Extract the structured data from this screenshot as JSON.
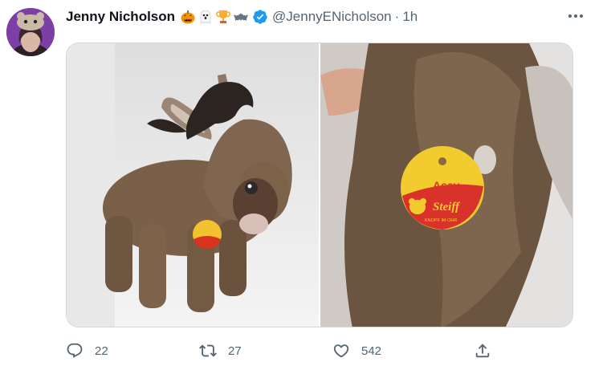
{
  "tweet": {
    "author": {
      "display_name": "Jenny Nicholson",
      "emojis": [
        "jack-o-lantern",
        "ghost",
        "trophy",
        "bat"
      ],
      "verified": true,
      "handle": "@JennyENicholson",
      "separator": "·",
      "time": "1h"
    },
    "media": {
      "count": 2,
      "tag_text_top": "Assy",
      "tag_text_bottom": "Steiff",
      "tag_text_small": "KNOPF IM OHR"
    },
    "actions": {
      "replies": "22",
      "retweets": "27",
      "likes": "542"
    }
  },
  "colors": {
    "text_primary": "#0f1419",
    "text_secondary": "#536471",
    "verified_blue": "#1d9bf0",
    "avatar_bg": "#7a3fa3",
    "border": "#cfd9de"
  }
}
